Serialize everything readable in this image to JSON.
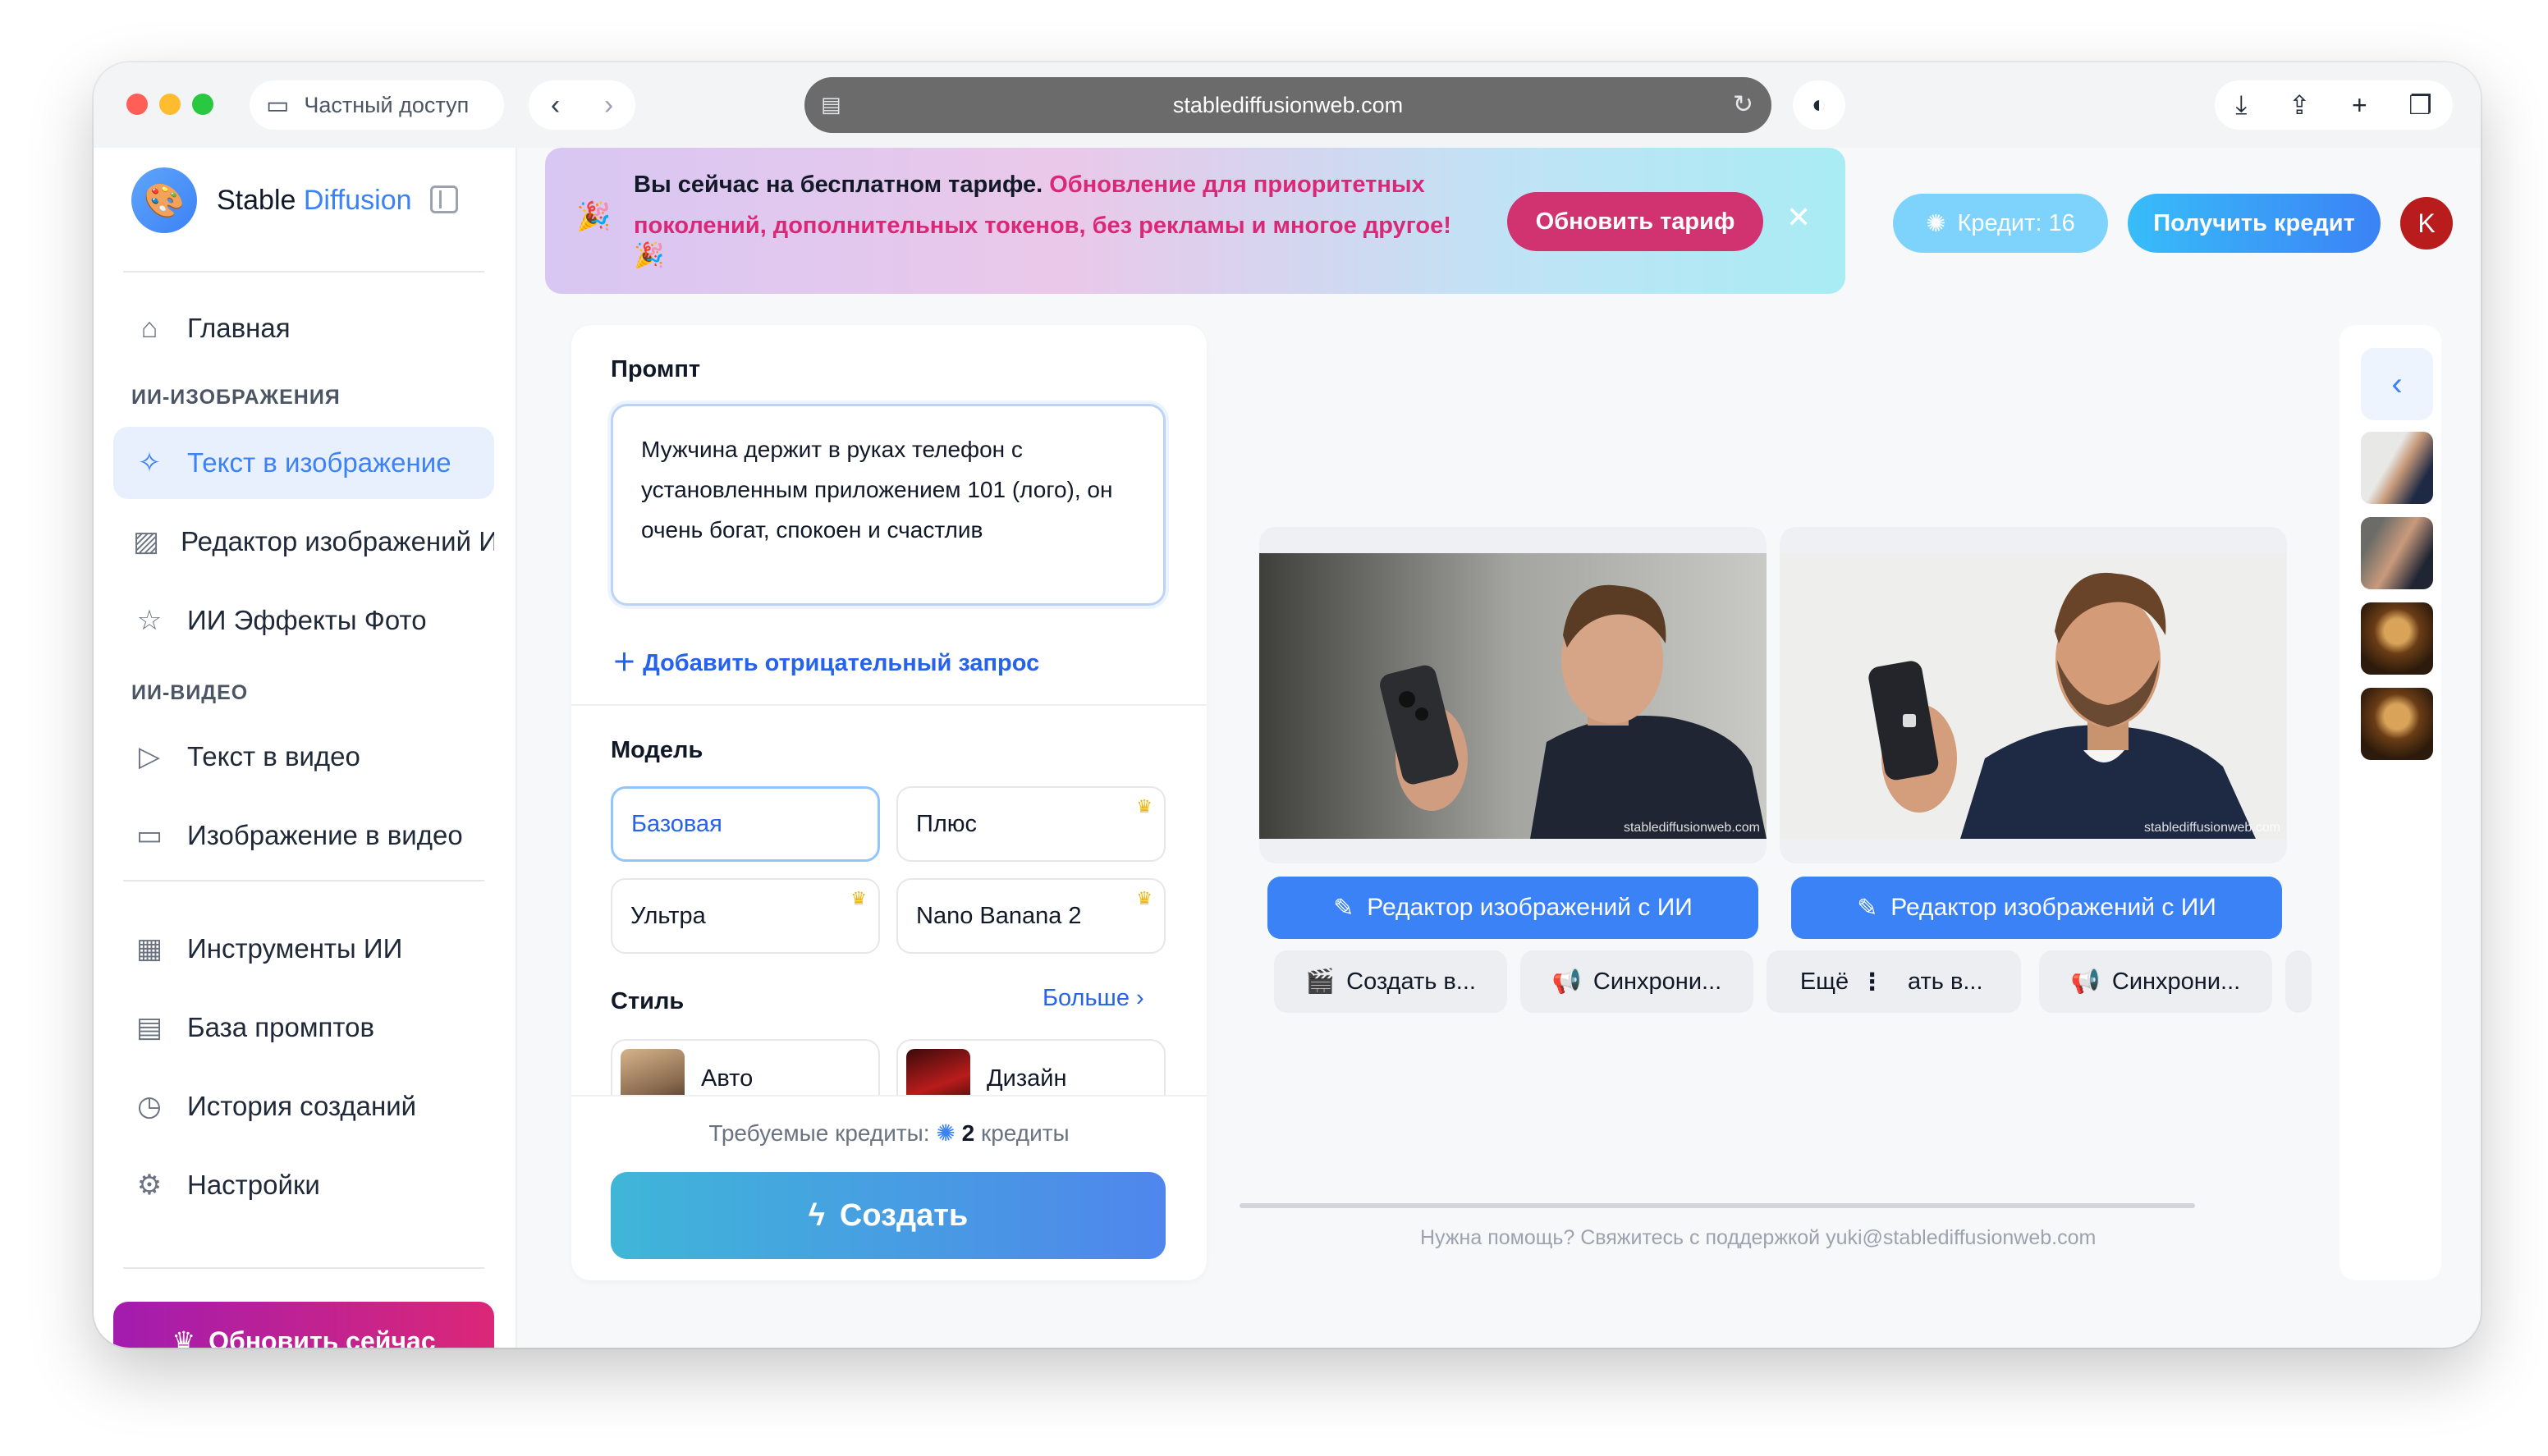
{
  "browser": {
    "private_label": "Частный доступ",
    "back_glyph": "‹",
    "forward_glyph": "›",
    "url": "stablediffusionweb.com"
  },
  "sidebar": {
    "brand_part1": "Stable",
    "brand_part2": "Diffusion",
    "items": {
      "home": "Главная",
      "ai_images_heading": "ИИ-ИЗОБРАЖЕНИЯ",
      "text_to_image": "Текст в изображение",
      "image_editor": "Редактор изображений ИИ",
      "photo_effects": "ИИ Эффекты Фото",
      "ai_video_heading": "ИИ-ВИДЕО",
      "text_to_video": "Текст в видео",
      "image_to_video": "Изображение в видео",
      "ai_tools": "Инструменты ИИ",
      "prompt_base": "База промптов",
      "history": "История созданий",
      "settings": "Настройки"
    },
    "upgrade_label": "Обновить сейчас"
  },
  "banner": {
    "text_plain": "Вы сейчас на бесплатном тарифе. ",
    "text_highlight": "Обновление для приоритетных поколений, дополнительных токенов, без рекламы и многое другое!",
    "button": "Обновить тариф",
    "close": "✕"
  },
  "header": {
    "credit_label": "Кредит: 16",
    "get_credit": "Получить кредит",
    "avatar_letter": "K"
  },
  "form": {
    "prompt_label": "Промпт",
    "prompt_value": "Мужчина держит в руках телефон с установленным приложением 101 (лого), он очень богат, спокоен и счастлив",
    "negative_link": "Добавить отрицательный запрос",
    "model_label": "Модель",
    "models": [
      "Базовая",
      "Плюс",
      "Ультра",
      "Nano Banana 2"
    ],
    "selected_model": "Базовая",
    "style_label": "Стиль",
    "more_link": "Больше",
    "styles": [
      "Авто",
      "Дизайн"
    ],
    "required_credits_label": "Требуемые кредиты:",
    "required_credits_value": "2",
    "required_credits_unit": "кредиты",
    "create_button": "Создать"
  },
  "results": {
    "watermark": "stablediffusionweb.com",
    "edit_button": "Редактор изображений с ИИ",
    "chips": {
      "create": "Создать в...",
      "sync": "Синхрони...",
      "more": "Ещё",
      "partial": "ать в...",
      "sync2": "Синхрони..."
    },
    "help_text": "Нужна помощь? Свяжитесь с поддержкой yuki@stablediffusionweb.com"
  },
  "history": {
    "back_glyph": "‹"
  },
  "colors": {
    "accent": "#3b82f6",
    "brand_pink": "#db2777",
    "upgrade_gradient_start": "#a21caf",
    "upgrade_gradient_end": "#db2777"
  }
}
